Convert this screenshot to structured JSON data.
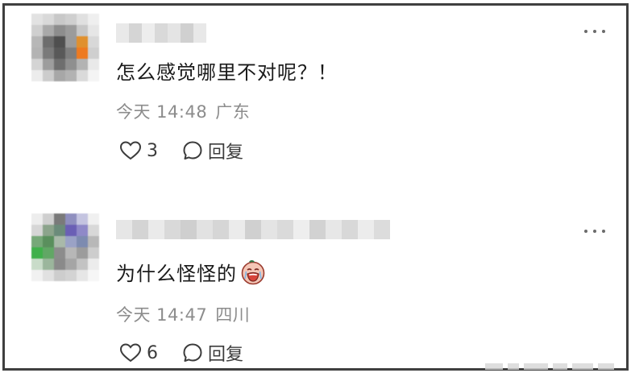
{
  "comments": [
    {
      "text": "怎么感觉哪里不对呢？！",
      "time": "今天 14:48",
      "location": "广东",
      "likes": "3",
      "reply_label": "回复"
    },
    {
      "text": "为什么怪怪的",
      "time": "今天 14:47",
      "location": "四川",
      "likes": "6",
      "reply_label": "回复",
      "emoji": "crying-face-emoji"
    }
  ],
  "colors": {
    "border": "#3f3f3f",
    "text": "#1a1a1a",
    "meta": "#8c8c8c",
    "icon": "#3c3c3c"
  },
  "icons": [
    "more-icon",
    "heart-icon",
    "comment-icon"
  ]
}
